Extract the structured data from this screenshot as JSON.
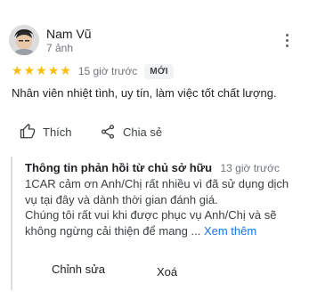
{
  "review": {
    "author": {
      "name": "Nam Vũ",
      "meta": "7 ảnh",
      "avatar_icon": "user-avatar-icon"
    },
    "more_icon": "more-vert-icon",
    "rating": {
      "stars": 5,
      "max": 5,
      "star_color": "#fbbc04",
      "time": "15 giờ trước",
      "badge": "MỚI"
    },
    "text": "Nhân viên nhiệt tình, uy tín, làm việc tốt chất lượng.",
    "actions": {
      "like_label": "Thích",
      "like_icon": "thumb-up-icon",
      "share_label": "Chia sẻ",
      "share_icon": "share-icon"
    },
    "owner_reply": {
      "title": "Thông tin phản hồi từ chủ sở hữu",
      "time": "13 giờ trước",
      "paragraph1": "1CAR cảm ơn Anh/Chị rất nhiều vì đã sử dụng dịch vụ tại đây và dành thời gian đánh giá.",
      "paragraph2": "Chúng tôi rất vui khi được phục vụ Anh/Chị và sẽ không ngừng cải thiện để mang ...",
      "see_more": "Xem thêm",
      "edit_label": "Chỉnh sửa",
      "delete_label": "Xoá",
      "accent_color": "#1a73e8"
    }
  }
}
